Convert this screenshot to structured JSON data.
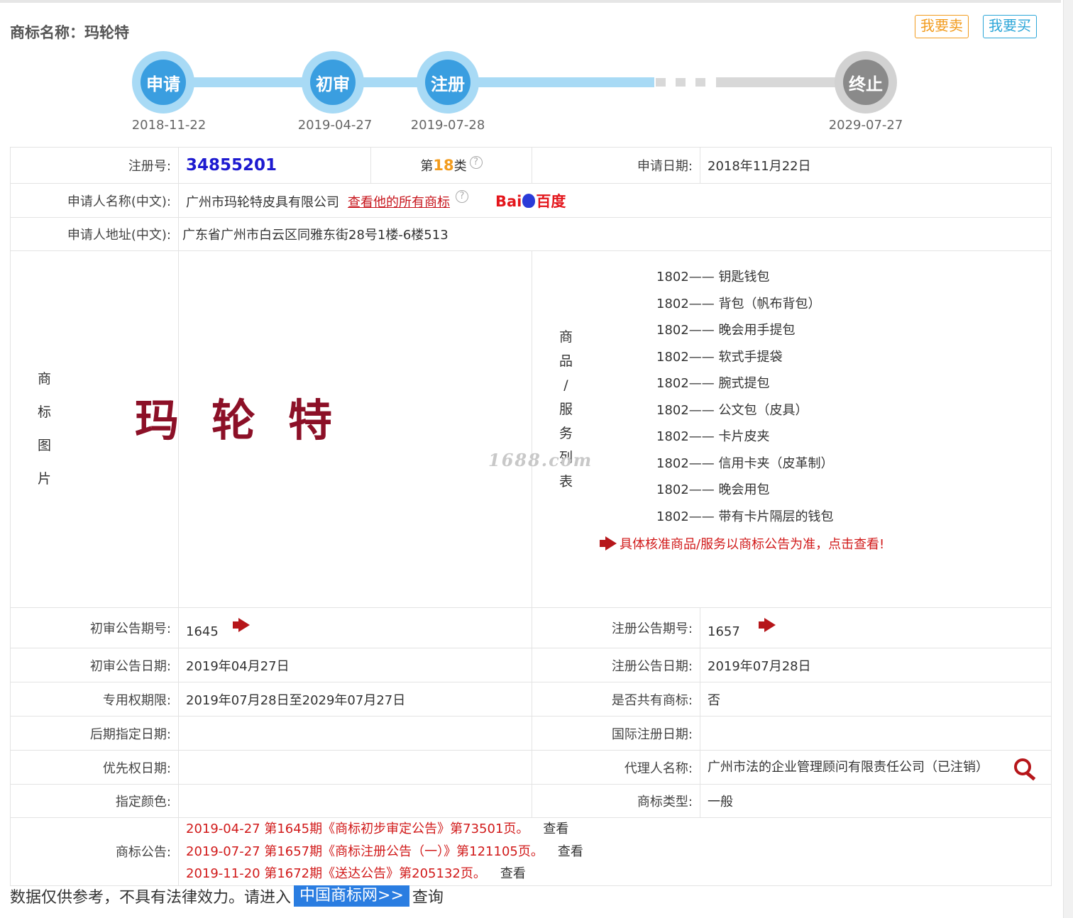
{
  "header": {
    "title": "商标名称：玛轮特",
    "sell_label": "我要卖",
    "buy_label": "我要买"
  },
  "timeline": {
    "steps": [
      {
        "label": "申请",
        "date": "2018-11-22"
      },
      {
        "label": "初审",
        "date": "2019-04-27"
      },
      {
        "label": "注册",
        "date": "2019-07-28"
      },
      {
        "label": "终止",
        "date": "2029-07-27"
      }
    ]
  },
  "info": {
    "reg_no_label": "注册号:",
    "reg_no": "34855201",
    "class_prefix": "第",
    "class_num": "18",
    "class_suffix": "类",
    "apply_date_label": "申请日期:",
    "apply_date": "2018年11月22日",
    "applicant_label": "申请人名称(中文):",
    "applicant": "广州市玛轮特皮具有限公司",
    "view_all_link": "查看他的所有商标",
    "baidu_left": "Bai",
    "baidu_right": "百度",
    "address_label": "申请人地址(中文):",
    "address": "广东省广州市白云区同雅东街28号1楼-6楼513",
    "image_label_chars": [
      "商",
      "标",
      "图",
      "片"
    ],
    "logo_text": "玛轮特",
    "goods_label_chars": [
      "商",
      "品",
      "/",
      "服",
      "务",
      "列",
      "表"
    ],
    "goods": [
      "1802—— 钥匙钱包",
      "1802—— 背包（帆布背包）",
      "1802—— 晚会用手提包",
      "1802—— 软式手提袋",
      "1802—— 腕式提包",
      "1802—— 公文包（皮具）",
      "1802—— 卡片皮夹",
      "1802—— 信用卡夹（皮革制）",
      "1802—— 晚会用包",
      "1802—— 带有卡片隔层的钱包"
    ],
    "goods_notice": "具体核准商品/服务以商标公告为准，点击查看!",
    "watermark": "1688.com",
    "prelim_no_label": "初审公告期号:",
    "prelim_no": "1645",
    "reg_pub_no_label": "注册公告期号:",
    "reg_pub_no": "1657",
    "prelim_date_label": "初审公告日期:",
    "prelim_date": "2019年04月27日",
    "reg_pub_date_label": "注册公告日期:",
    "reg_pub_date": "2019年07月28日",
    "exclusive_label": "专用权期限:",
    "exclusive": "2019年07月28日至2029年07月27日",
    "shared_label": "是否共有商标:",
    "shared": "否",
    "later_label": "后期指定日期:",
    "later": "",
    "intl_label": "国际注册日期:",
    "intl": "",
    "priority_label": "优先权日期:",
    "priority": "",
    "agent_label": "代理人名称:",
    "agent": "广州市法的企业管理顾问有限责任公司（已注销）",
    "color_label": "指定颜色:",
    "color": "",
    "type_label": "商标类型:",
    "type": "一般",
    "notices_label": "商标公告:",
    "notices": [
      {
        "text": "2019-04-27 第1645期《商标初步审定公告》第73501页。",
        "view": "查看"
      },
      {
        "text": "2019-07-27 第1657期《商标注册公告（一）》第121105页。",
        "view": "查看"
      },
      {
        "text": "2019-11-20 第1672期《送达公告》第205132页。",
        "view": "查看"
      }
    ]
  },
  "footer": {
    "prefix": "数据仅供参考，不具有法律效力。请进入",
    "link": "中国商标网>>",
    "suffix": "查询"
  },
  "colors": {
    "step_blue": "#3a9ee0",
    "track_blue": "#a8daf5",
    "step_gray": "#8a8a8a",
    "sell_orange": "#f29b1d",
    "buy_blue": "#2ca6d8",
    "reg_no_blue": "#1d1ad0",
    "notice_red": "#d11a1a",
    "logo_red": "#8c1027"
  }
}
